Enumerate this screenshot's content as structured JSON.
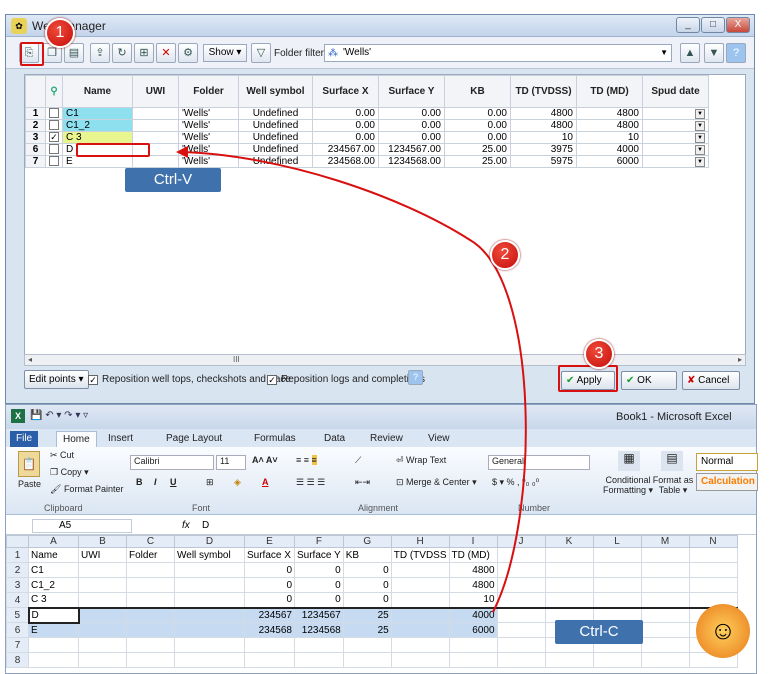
{
  "petrel": {
    "title": "Well manager",
    "controls": [
      "_",
      "□",
      "X"
    ],
    "toolbar": {
      "show": "Show ▾",
      "folder_filter_label": "Folder filter:",
      "folder_filter_value": "'Wells'"
    },
    "columns": [
      "",
      "",
      "Name",
      "UWI",
      "Folder",
      "Well symbol",
      "Surface X",
      "Surface Y",
      "KB",
      "TD (TVDSS)",
      "TD (MD)",
      "Spud date"
    ],
    "rows": [
      {
        "n": "1",
        "checked": false,
        "name": "C1",
        "uwi": "",
        "folder": "'Wells'",
        "sym": "Undefined",
        "sx": "0.00",
        "sy": "0.00",
        "kb": "0.00",
        "tvdss": "4800",
        "md": "4800",
        "color": "#8fe0ef"
      },
      {
        "n": "2",
        "checked": false,
        "name": "C1_2",
        "uwi": "",
        "folder": "'Wells'",
        "sym": "Undefined",
        "sx": "0.00",
        "sy": "0.00",
        "kb": "0.00",
        "tvdss": "4800",
        "md": "4800",
        "color": "#8fe0ef"
      },
      {
        "n": "3",
        "checked": true,
        "name": "C 3",
        "uwi": "",
        "folder": "'Wells'",
        "sym": "Undefined",
        "sx": "0.00",
        "sy": "0.00",
        "kb": "0.00",
        "tvdss": "10",
        "md": "10",
        "color": "#e9f58f"
      },
      {
        "n": "6",
        "checked": false,
        "name": "D",
        "uwi": "",
        "folder": "'Wells'",
        "sym": "Undefined",
        "sx": "234567.00",
        "sy": "1234567.00",
        "kb": "25.00",
        "tvdss": "3975",
        "md": "4000",
        "color": "#ffffff"
      },
      {
        "n": "7",
        "checked": false,
        "name": "E",
        "uwi": "",
        "folder": "'Wells'",
        "sym": "Undefined",
        "sx": "234568.00",
        "sy": "1234568.00",
        "kb": "25.00",
        "tvdss": "5975",
        "md": "6000",
        "color": "#ffffff"
      }
    ],
    "scroll_mark": "III",
    "bottom": {
      "edit_points": "Edit points ▾",
      "reposition_tops": "Reposition well tops, checkshots and trace",
      "reposition_logs": "Reposition logs and completions",
      "apply": "Apply",
      "ok": "OK",
      "cancel": "Cancel"
    }
  },
  "excel": {
    "title": "Book1 - Microsoft Excel",
    "tabs": [
      "File",
      "Home",
      "Insert",
      "Page Layout",
      "Formulas",
      "Data",
      "Review",
      "View"
    ],
    "ribbon": {
      "cut": "Cut",
      "copy": "Copy ▾",
      "paste": "Paste",
      "format_painter": "Format Painter",
      "clipboard": "Clipboard",
      "font_name": "Calibri",
      "font_size": "11",
      "font": "Font",
      "wrap": "Wrap Text",
      "merge": "Merge & Center ▾",
      "alignment": "Alignment",
      "number_format": "General",
      "number": "Number",
      "cond_fmt": "Conditional Formatting ▾",
      "fmt_table": "Format as Table ▾",
      "style_normal": "Normal",
      "style_calc": "Calculation"
    },
    "name_box": "A5",
    "fx": "fx",
    "formula": "D",
    "cols": [
      "",
      "A",
      "B",
      "C",
      "D",
      "E",
      "F",
      "G",
      "H",
      "I",
      "J",
      "K",
      "L",
      "M",
      "N"
    ],
    "rows": [
      [
        "1",
        "Name",
        "UWI",
        "Folder",
        "Well symbol",
        "Surface X",
        "Surface Y",
        "KB",
        "TD (TVDSS",
        "TD (MD)",
        "",
        "",
        "",
        "",
        ""
      ],
      [
        "2",
        "C1",
        "",
        "",
        "",
        "0",
        "0",
        "0",
        "",
        "4800",
        "",
        "",
        "",
        "",
        ""
      ],
      [
        "3",
        "C1_2",
        "",
        "",
        "",
        "0",
        "0",
        "0",
        "",
        "4800",
        "",
        "",
        "",
        "",
        ""
      ],
      [
        "4",
        "C 3",
        "",
        "",
        "",
        "0",
        "0",
        "0",
        "",
        "10",
        "",
        "",
        "",
        "",
        ""
      ],
      [
        "5",
        "D",
        "",
        "",
        "",
        "234567",
        "1234567",
        "25",
        "",
        "4000",
        "",
        "",
        "",
        "",
        ""
      ],
      [
        "6",
        "E",
        "",
        "",
        "",
        "234568",
        "1234568",
        "25",
        "",
        "6000",
        "",
        "",
        "",
        "",
        ""
      ],
      [
        "7",
        "",
        "",
        "",
        "",
        "",
        "",
        "",
        "",
        "",
        "",
        "",
        "",
        "",
        ""
      ],
      [
        "8",
        "",
        "",
        "",
        "",
        "",
        "",
        "",
        "",
        "",
        "",
        "",
        "",
        "",
        ""
      ]
    ]
  },
  "annotations": {
    "b1": "1",
    "b2": "2",
    "b3": "3",
    "ctrl_v": "Ctrl-V",
    "ctrl_c": "Ctrl-C",
    "accent": "#d81010"
  }
}
